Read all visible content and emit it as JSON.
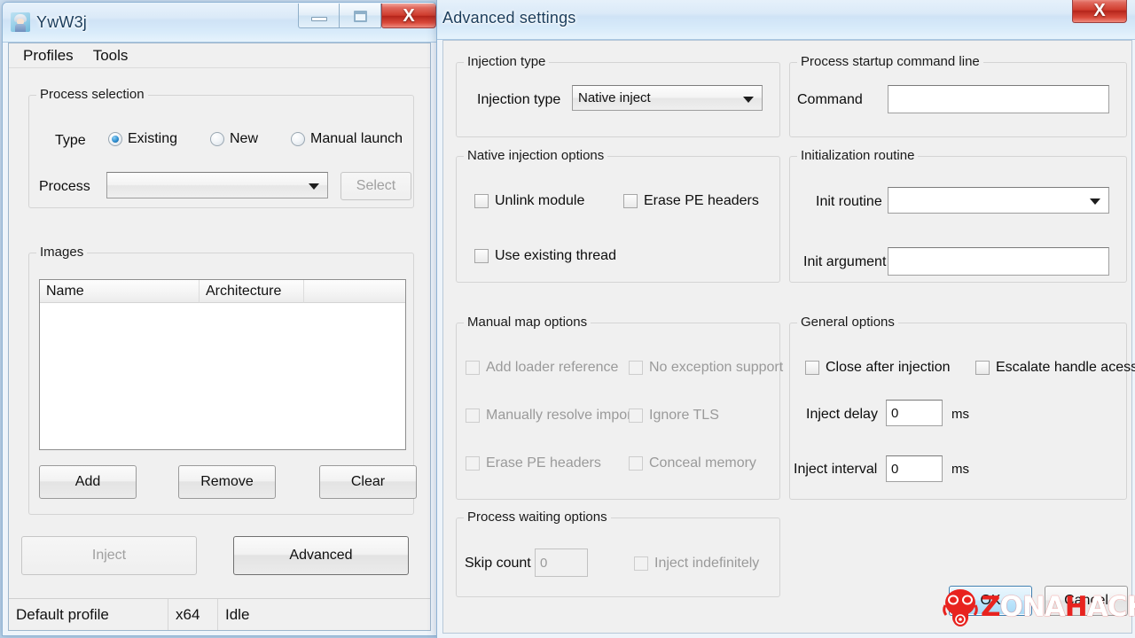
{
  "main_window": {
    "title": "YwW3j",
    "icon": "app-avatar-icon",
    "caption": {
      "minimize": "–",
      "maximize": "□",
      "close": "X"
    },
    "menu": [
      {
        "label": "Profiles"
      },
      {
        "label": "Tools"
      }
    ],
    "process_selection": {
      "legend": "Process selection",
      "type_label": "Type",
      "radios": [
        {
          "label": "Existing",
          "checked": true
        },
        {
          "label": "New",
          "checked": false
        },
        {
          "label": "Manual launch",
          "checked": false
        }
      ],
      "process_label": "Process",
      "process_value": "",
      "select_button": "Select"
    },
    "images": {
      "legend": "Images",
      "columns": [
        "Name",
        "Architecture",
        ""
      ],
      "rows": [],
      "buttons": [
        "Add",
        "Remove",
        "Clear"
      ]
    },
    "actions": {
      "inject": "Inject",
      "advanced": "Advanced"
    },
    "status": {
      "profile": "Default profile",
      "arch": "x64",
      "state": "Idle"
    }
  },
  "advanced_window": {
    "title": "Advanced settings",
    "caption": {
      "close": "X"
    },
    "injection_type": {
      "legend": "Injection type",
      "label": "Injection type",
      "value": "Native inject"
    },
    "startup_command": {
      "legend": "Process startup command line",
      "label": "Command",
      "value": ""
    },
    "native_options": {
      "legend": "Native injection options",
      "items": [
        {
          "label": "Unlink module",
          "checked": false,
          "disabled": false
        },
        {
          "label": "Erase PE headers",
          "checked": false,
          "disabled": false
        },
        {
          "label": "Use existing thread",
          "checked": false,
          "disabled": false
        }
      ]
    },
    "init_routine": {
      "legend": "Initialization routine",
      "routine_label": "Init routine",
      "routine_value": "",
      "argument_label": "Init argument",
      "argument_value": ""
    },
    "manual_map": {
      "legend": "Manual map options",
      "items": [
        {
          "label": "Add loader reference",
          "checked": false,
          "disabled": true
        },
        {
          "label": "No exception support",
          "checked": false,
          "disabled": true
        },
        {
          "label": "Manually resolve imports",
          "checked": false,
          "disabled": true
        },
        {
          "label": "Ignore TLS",
          "checked": false,
          "disabled": true
        },
        {
          "label": "Erase PE headers",
          "checked": false,
          "disabled": true
        },
        {
          "label": "Conceal memory",
          "checked": false,
          "disabled": true
        }
      ]
    },
    "general_options": {
      "legend": "General options",
      "close_after_injection": "Close after injection",
      "escalate_handle": "Escalate handle acess",
      "inject_delay_label": "Inject delay",
      "inject_delay_value": "0",
      "inject_delay_unit": "ms",
      "inject_interval_label": "Inject interval",
      "inject_interval_value": "0",
      "inject_interval_unit": "ms"
    },
    "waiting_options": {
      "legend": "Process waiting options",
      "skip_count_label": "Skip count",
      "skip_count_value": "0",
      "inject_indefinitely": "Inject indefinitely"
    },
    "footer": {
      "ok": "OK",
      "cancel": "Cancel"
    }
  },
  "watermark": {
    "text_part1": "Z",
    "text_part2": "ONA",
    "text_part3": "H",
    "text_part4": "ACK",
    "color_red": "#e8231f",
    "color_white": "#ffffff"
  }
}
